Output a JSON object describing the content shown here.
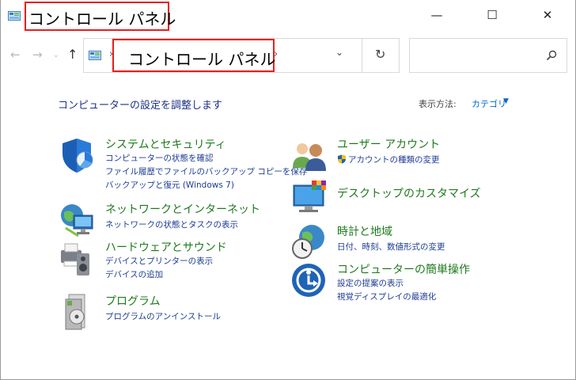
{
  "window": {
    "title": "コントロール パネル",
    "minimize_glyph": "—",
    "maximize_glyph": "☐",
    "close_glyph": "✕"
  },
  "nav": {
    "back_glyph": "←",
    "forward_glyph": "→",
    "recent_glyph": "⌄",
    "up_glyph": "↑"
  },
  "address": {
    "sep1": "›",
    "location": "コントロール パネル",
    "sep2": "›",
    "dropdown_glyph": "⌄",
    "refresh_glyph": "↻"
  },
  "search": {
    "placeholder": ""
  },
  "main": {
    "heading": "コンピューターの設定を調整します",
    "view_by_label": "表示方法:",
    "view_by_value": "カテゴリ",
    "view_by_caret": "▼"
  },
  "left_categories": [
    {
      "title": "システムとセキュリティ",
      "icon": "shield-pie-icon",
      "links": [
        "コンピューターの状態を確認",
        "ファイル履歴でファイルのバックアップ コピーを保存",
        "バックアップと復元 (Windows 7)"
      ]
    },
    {
      "title": "ネットワークとインターネット",
      "icon": "network-globe-icon",
      "links": [
        "ネットワークの状態とタスクの表示"
      ]
    },
    {
      "title": "ハードウェアとサウンド",
      "icon": "printer-speaker-icon",
      "links": [
        "デバイスとプリンターの表示",
        "デバイスの追加"
      ]
    },
    {
      "title": "プログラム",
      "icon": "programs-disc-icon",
      "links": [
        "プログラムのアンインストール"
      ]
    }
  ],
  "right_categories": [
    {
      "title": "ユーザー アカウント",
      "icon": "users-icon",
      "links": [
        "アカウントの種類の変更"
      ]
    },
    {
      "title": "デスクトップのカスタマイズ",
      "icon": "monitor-palette-icon",
      "links": []
    },
    {
      "title": "時計と地域",
      "icon": "clock-globe-icon",
      "links": [
        "日付、時刻、数値形式の変更"
      ]
    },
    {
      "title": "コンピューターの簡単操作",
      "icon": "ease-of-access-icon",
      "links": [
        "設定の提案の表示",
        "視覚ディスプレイの最適化"
      ]
    }
  ],
  "colors": {
    "category_title": "#1e7a1e",
    "link": "#1e3c96",
    "heading": "#1e3287",
    "highlight_box": "#e81e1e"
  }
}
